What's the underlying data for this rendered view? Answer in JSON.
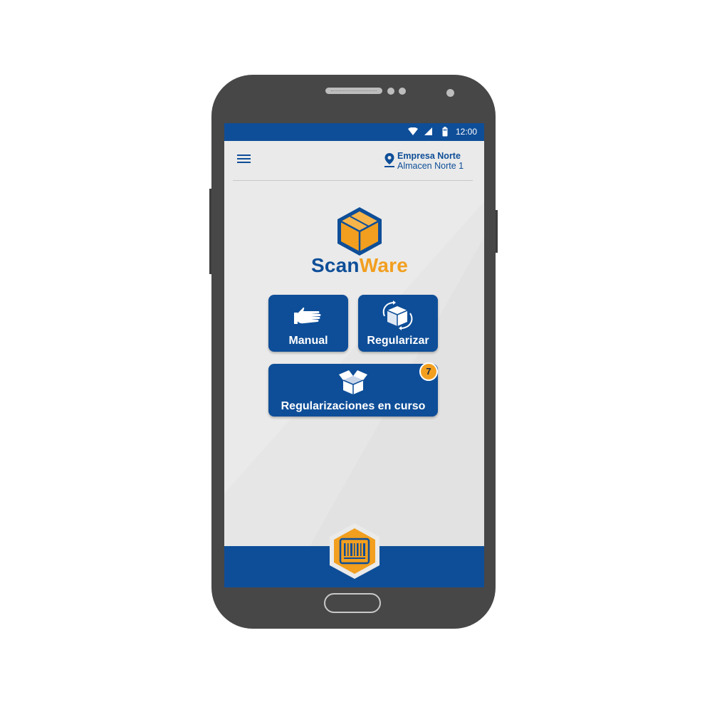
{
  "statusbar": {
    "time": "12:00",
    "icons": [
      "wifi-icon",
      "signal-icon",
      "battery-icon"
    ]
  },
  "appbar": {
    "menu_icon": "hamburger-menu-icon",
    "location_icon": "map-pin-icon",
    "company": "Empresa Norte",
    "warehouse": "Almacen Norte 1"
  },
  "logo": {
    "part1": "Scan",
    "part2": "Ware",
    "icon": "box-cube-icon"
  },
  "actions": [
    {
      "label": "Manual",
      "icon": "hand-icon"
    },
    {
      "label": "Regularizar",
      "icon": "box-rotate-icon"
    },
    {
      "label": "Regularizaciones en curso",
      "icon": "open-box-icon",
      "badge": "7"
    }
  ],
  "scan_button": {
    "icon": "barcode-icon"
  },
  "colors": {
    "primary": "#0e4e98",
    "accent": "#f29f1f",
    "phone_body": "#474747",
    "screen_bg": "#eaeaea"
  }
}
